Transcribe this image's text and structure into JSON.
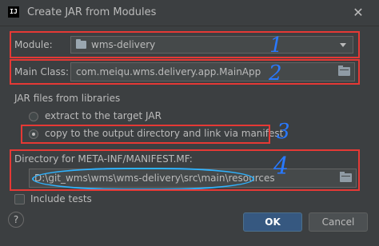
{
  "window": {
    "app_icon_text": "IJ",
    "title": "Create JAR from Modules",
    "close_glyph": "✕"
  },
  "module": {
    "label": "Module:",
    "value": "wms-delivery",
    "icon": "module-folder-icon"
  },
  "main_class": {
    "label": "Main Class:",
    "value": "com.meiqu.wms.delivery.app.MainApp",
    "browse_icon": "folder-icon"
  },
  "jar_files": {
    "section_label": "JAR files from libraries",
    "option_extract": "extract to the target JAR",
    "option_copy": "copy to the output directory and link via manifest",
    "selected": "copy"
  },
  "manifest_dir": {
    "label": "Directory for META-INF/MANIFEST.MF:",
    "value": "D:\\git_wms\\wms\\wms-delivery\\src\\main\\resources",
    "browse_icon": "folder-icon"
  },
  "include_tests": {
    "label": "Include tests",
    "checked": false
  },
  "buttons": {
    "help": "?",
    "ok": "OK",
    "cancel": "Cancel"
  },
  "annotations": {
    "num1": "1",
    "num2": "2",
    "num3": "3",
    "num4": "4",
    "box_color": "#e53935",
    "number_color": "#2979ff",
    "underline_color": "#2fb3ff"
  }
}
